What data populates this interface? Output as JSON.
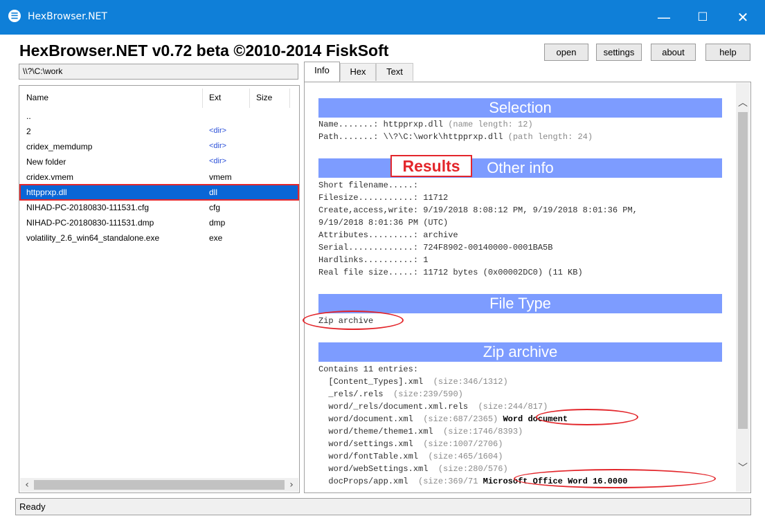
{
  "window": {
    "title": "HexBrowser.NET",
    "minimize": "—",
    "maximize": "☐",
    "close": "✕"
  },
  "app_heading": "HexBrowser.NET v0.72 beta  ©2010-2014 FiskSoft",
  "toolbar": {
    "open": "open",
    "settings": "settings",
    "about": "about",
    "help": "help"
  },
  "path": "\\\\?\\C:\\work",
  "file_list": {
    "columns": [
      "Name",
      "Ext",
      "Size"
    ],
    "rows": [
      {
        "name": "..",
        "ext": ""
      },
      {
        "name": "2",
        "ext": "<dir>"
      },
      {
        "name": "cridex_memdump",
        "ext": "<dir>"
      },
      {
        "name": "New folder",
        "ext": "<dir>"
      },
      {
        "name": "cridex.vmem",
        "ext": "vmem"
      },
      {
        "name": "httpprxp.dll",
        "ext": "dll",
        "selected": true
      },
      {
        "name": "NIHAD-PC-20180830-111531.cfg",
        "ext": "cfg"
      },
      {
        "name": "NIHAD-PC-20180830-111531.dmp",
        "ext": "dmp"
      },
      {
        "name": "volatility_2.6_win64_standalone.exe",
        "ext": "exe"
      }
    ]
  },
  "tabs": [
    "Info",
    "Hex",
    "Text"
  ],
  "info": {
    "selection": {
      "title": "Selection",
      "name_line": "Name.......: httpprxp.dll",
      "name_note": " (name length: 12)",
      "path_line": "Path.......: \\\\?\\C:\\work\\httpprxp.dll",
      "path_note": " (path length: 24)"
    },
    "other_info": {
      "title": "Other info",
      "lines": [
        "Short filename.....: ",
        "Filesize...........: 11712",
        "Create,access,write: 9/19/2018 8:08:12 PM, 9/19/2018 8:01:36 PM,",
        "9/19/2018 8:01:36 PM (UTC)",
        "Attributes.........: archive",
        "Serial.............: 724F8902-00140000-0001BA5B",
        "Hardlinks..........: 1",
        "Real file size.....: 11712 bytes (0x00002DC0) (11 KB)"
      ]
    },
    "file_type": {
      "title": "File Type",
      "value": "Zip archive"
    },
    "zip": {
      "title": "Zip archive",
      "header": "Contains 11 entries:",
      "entries": [
        {
          "name": "  [Content_Types].xml",
          "size": "  (size:346/1312)",
          "note": ""
        },
        {
          "name": "  _rels/.rels",
          "size": "  (size:239/590)",
          "note": ""
        },
        {
          "name": "  word/_rels/document.xml.rels",
          "size": "  (size:244/817)",
          "note": ""
        },
        {
          "name": "  word/document.xml",
          "size": "  (size:687/2365)",
          "note": " Word document"
        },
        {
          "name": "  word/theme/theme1.xml",
          "size": "  (size:1746/8393)",
          "note": ""
        },
        {
          "name": "  word/settings.xml",
          "size": "  (size:1007/2706)",
          "note": ""
        },
        {
          "name": "  word/fontTable.xml",
          "size": "  (size:465/1604)",
          "note": ""
        },
        {
          "name": "  word/webSettings.xml",
          "size": "  (size:280/576)",
          "note": ""
        },
        {
          "name": "  docProps/app.xml",
          "size": "  (size:369/71",
          "note": " Microsoft Office Word 16.0000"
        }
      ]
    }
  },
  "annotation": {
    "results_label": "Results",
    "color": "#e3262b"
  },
  "status": "Ready",
  "colors": {
    "titlebar": "#0f7fd8",
    "section_header": "#7d9cff",
    "selected_row": "#0a66d6",
    "dir_text": "#2a4fd8"
  }
}
